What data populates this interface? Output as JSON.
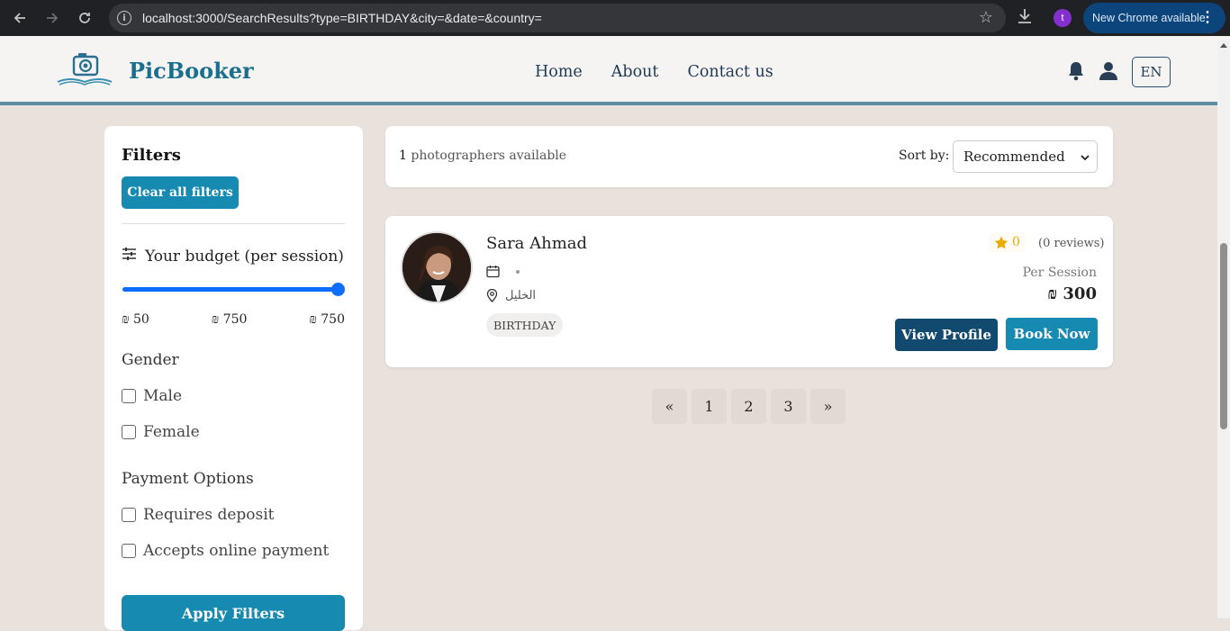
{
  "browser": {
    "url": "localhost:3000/SearchResults?type=BIRTHDAY&city=&date=&country=",
    "profile_initial": "t",
    "update_label": "New Chrome available"
  },
  "header": {
    "brand": "PicBooker",
    "nav": [
      "Home",
      "About",
      "Contact us"
    ],
    "lang": "EN"
  },
  "filters": {
    "title": "Filters",
    "clear_label": "Clear all filters",
    "budget_title": "Your budget (per session)",
    "budget_min": "₪ 50",
    "budget_mid": "₪ 750",
    "budget_max": "₪ 750",
    "budget_level": 1.0,
    "gender_title": "Gender",
    "gender_options": [
      "Male",
      "Female"
    ],
    "payment_title": "Payment Options",
    "payment_options": [
      "Requires deposit",
      "Accepts online payment"
    ],
    "apply_label": "Apply Filters"
  },
  "results": {
    "count": "1",
    "count_suffix": "photographers available",
    "sort_label": "Sort by:",
    "sort_value": "Recommended"
  },
  "card": {
    "name": "Sara Ahmad",
    "location": "الخليل",
    "tag": "BIRTHDAY",
    "rating": "0",
    "reviews": "(0 reviews)",
    "per_session": "Per Session",
    "price": "₪ 300",
    "view_label": "View Profile",
    "book_label": "Book Now"
  },
  "pagination": {
    "prev": "«",
    "pages": [
      "1",
      "2",
      "3"
    ],
    "next": "»"
  },
  "colors": {
    "brand": "#1b6f8e",
    "primary_button": "#178ab1",
    "dark_button": "#114a6e",
    "page_bg": "#e8e1dc",
    "star": "#e8ab00"
  }
}
